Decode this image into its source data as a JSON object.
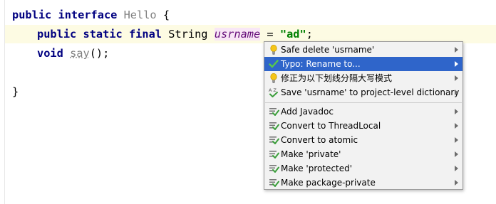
{
  "editor": {
    "line1": {
      "kw1": "public",
      "kw2": "interface",
      "name": "Hello",
      "brace": "{"
    },
    "line2": {
      "kw1": "public",
      "kw2": "static",
      "kw3": "final",
      "type": "String",
      "field": "usrname",
      "eq": "=",
      "value": "\"ad\"",
      "semi": ";"
    },
    "line3": {
      "kw": "void",
      "method": "say",
      "rest": "();"
    },
    "line5": {
      "brace": "}"
    }
  },
  "popup": {
    "items": [
      {
        "label": "Safe delete 'usrname'",
        "icon": "bulb-icon"
      },
      {
        "label": "Typo: Rename to...",
        "icon": "check-icon",
        "selected": true
      },
      {
        "label": "修正为以下划线分隔大写模式",
        "icon": "bulb-icon"
      },
      {
        "label": "Save 'usrname' to project-level dictionary",
        "icon": "spellcheck-icon"
      },
      {
        "label": "Add Javadoc",
        "icon": "intention-icon"
      },
      {
        "label": "Convert to ThreadLocal",
        "icon": "intention-icon"
      },
      {
        "label": "Convert to atomic",
        "icon": "intention-icon"
      },
      {
        "label": "Make 'private'",
        "icon": "intention-icon"
      },
      {
        "label": "Make 'protected'",
        "icon": "intention-icon"
      },
      {
        "label": "Make package-private",
        "icon": "intention-icon"
      }
    ]
  },
  "colors": {
    "selection": "#2f65ca",
    "bulb": "#f5c518",
    "intention_green": "#3c9e3c"
  }
}
